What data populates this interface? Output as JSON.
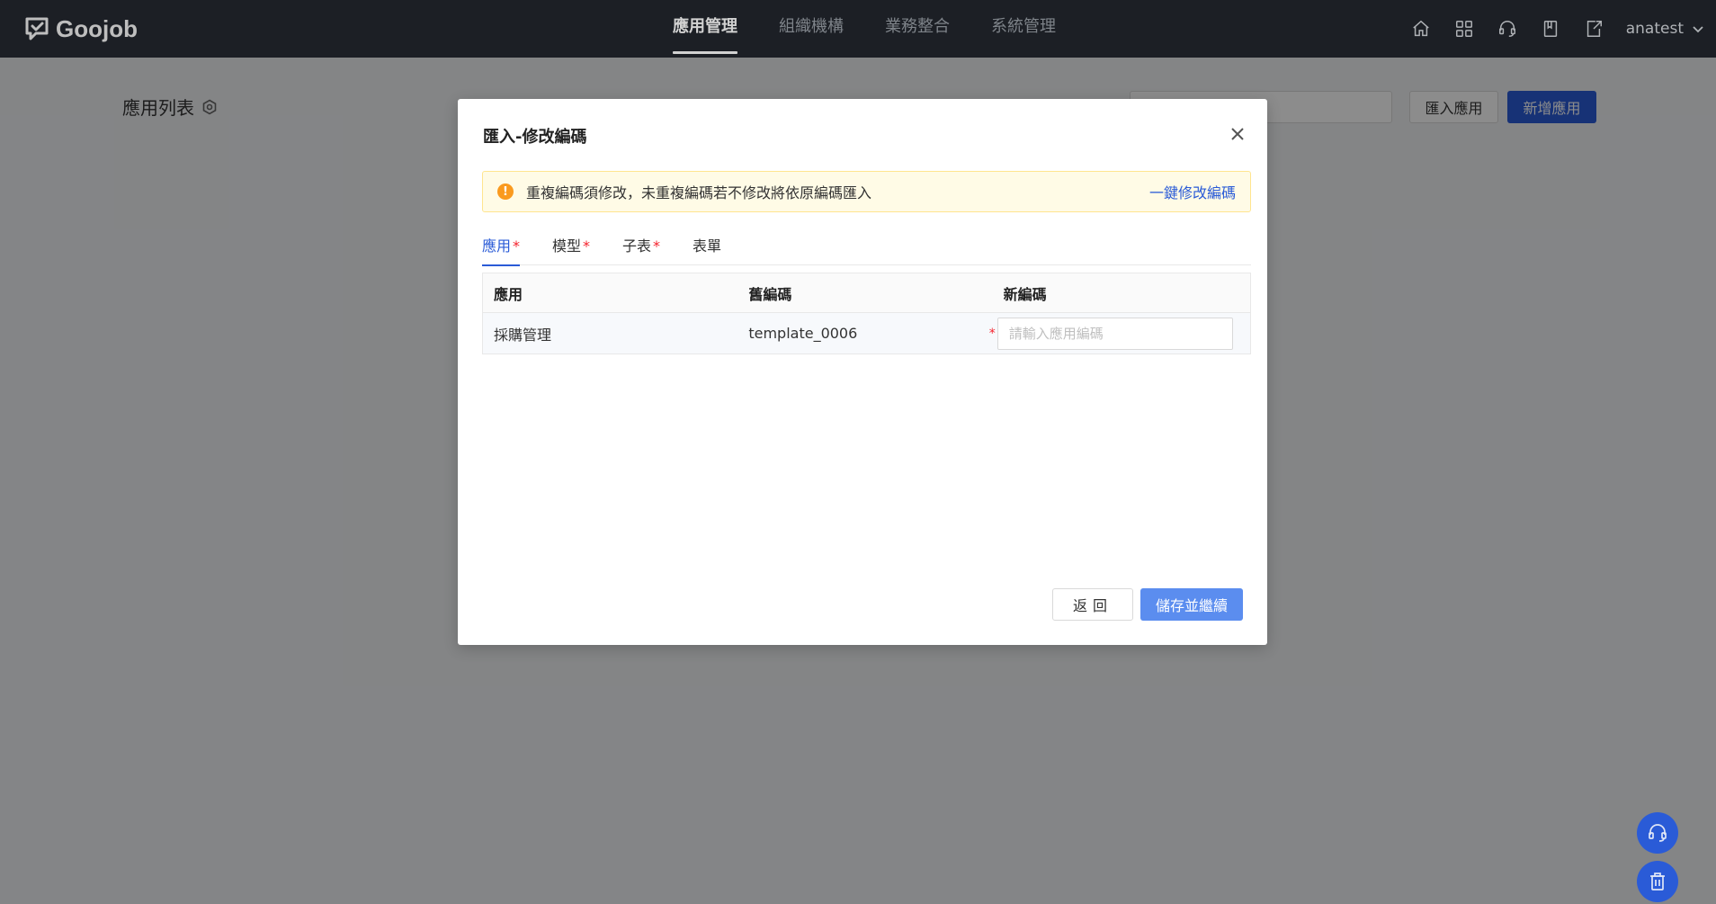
{
  "app": {
    "logo_text": "Goojob",
    "nav": [
      {
        "label": "應用管理",
        "active": true
      },
      {
        "label": "組織機構",
        "active": false
      },
      {
        "label": "業務整合",
        "active": false
      },
      {
        "label": "系統管理",
        "active": false
      }
    ],
    "icons": [
      "home-icon",
      "apps-grid-icon",
      "support-icon",
      "book-icon",
      "export-icon"
    ],
    "username": "anatest"
  },
  "page": {
    "title": "應用列表",
    "import_label": "匯入應用",
    "add_label": "新增應用"
  },
  "modal": {
    "title": "匯入-修改編碼",
    "alert": {
      "text": "重複編碼須修改，未重複編碼若不修改將依原編碼匯入",
      "link": "一鍵修改編碼"
    },
    "tabs": [
      {
        "label": "應用",
        "required": "*",
        "active": true
      },
      {
        "label": "模型",
        "required": "*",
        "active": false
      },
      {
        "label": "子表",
        "required": "*",
        "active": false
      },
      {
        "label": "表單",
        "required": "",
        "active": false
      }
    ],
    "table": {
      "headers": [
        "應用",
        "舊編碼",
        "新編碼"
      ],
      "rows": [
        {
          "name": "採購管理",
          "old_code": "template_0006",
          "new_code": "",
          "placeholder": "請輸入應用編碼",
          "required": "*"
        }
      ]
    },
    "back_label": "返回",
    "save_label": "儲存並繼續"
  },
  "colors": {
    "primary": "#2a5bd7",
    "topbar": "#23272e",
    "warning": "#fa9a1e",
    "required": "#f5222d"
  }
}
